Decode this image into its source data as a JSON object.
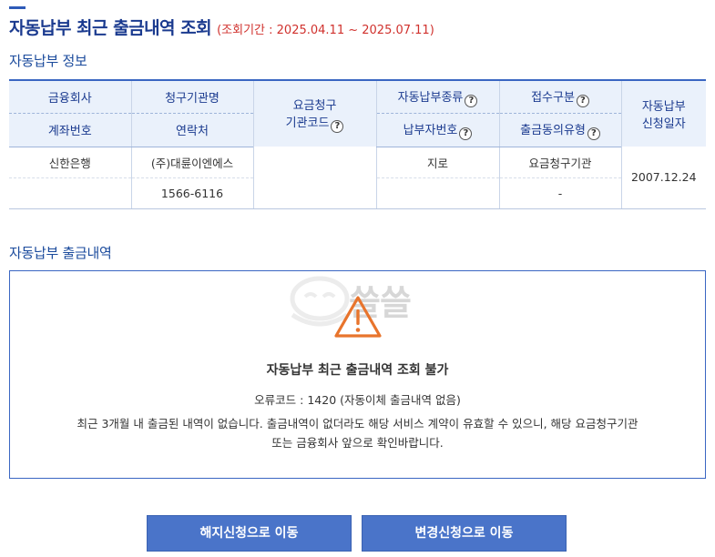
{
  "header": {
    "title": "자동납부 최근 출금내역 조회",
    "period": "(조회기간 : 2025.04.11 ~ 2025.07.11)"
  },
  "info_section": {
    "title": "자동납부 정보",
    "columns": {
      "bank": "금융회사",
      "account_no": "계좌번호",
      "biller_name": "청구기관명",
      "contact": "연락처",
      "biller_code_line1": "요금청구",
      "biller_code_line2": "기관코드",
      "payment_type": "자동납부종류",
      "payer_no": "납부자번호",
      "receipt_type": "접수구분",
      "consent_type": "출금동의유형",
      "apply_date_line1": "자동납부",
      "apply_date_line2": "신청일자"
    },
    "row": {
      "bank": "신한은행",
      "account_no": "",
      "biller_name": "(주)대륜이엔에스",
      "contact": "1566-6116",
      "biller_code": "",
      "payment_type": "지로",
      "payer_no": "",
      "receipt_type": "요금청구기관",
      "consent_type": "-",
      "apply_date": "2007.12.24"
    },
    "help_icon_glyph": "?"
  },
  "history_section": {
    "title": "자동납부 출금내역",
    "watermark": "쓸쓸",
    "notice_title": "자동납부 최근 출금내역 조회 불가",
    "error_code": "오류코드 : 1420 (자동이체 출금내역 없음)",
    "message_line1": "최근 3개월 내 출금된 내역이 없습니다. 출금내역이 없더라도 해당 서비스 계약이 유효할 수 있으니, 해당 요금청구기관",
    "message_line2": "또는 금융회사 앞으로 확인바랍니다.",
    "warning_icon": "warning-triangle-icon"
  },
  "buttons": {
    "cancel": "해지신청으로 이동",
    "change": "변경신청으로 이동"
  },
  "colors": {
    "accent": "#2e5bb8",
    "title": "#1a3a8f",
    "period": "#d0312d",
    "button": "#4a74c9",
    "warning": "#e8742c"
  }
}
